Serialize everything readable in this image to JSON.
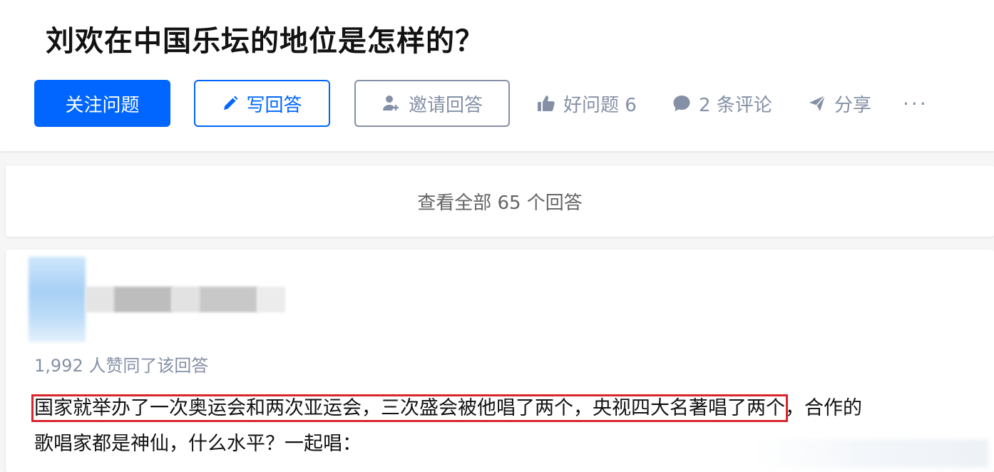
{
  "question": {
    "title": "刘欢在中国乐坛的地位是怎样的？",
    "follow_label": "关注问题",
    "write_label": "写回答",
    "invite_label": "邀请回答",
    "good_question": "好问题 6",
    "comments": "2 条评论",
    "share": "分享",
    "more": "···"
  },
  "view_all": {
    "label": "查看全部 65 个回答"
  },
  "answer": {
    "votes": "1,992 人赞同了该回答",
    "highlighted": "国家就举办了一次奥运会和两次亚运会，三次盛会被他唱了两个，央视四大名著唱了两个",
    "line1_rest": "，合作的",
    "line2": "歌唱家都是神仙，什么水平？一起唱："
  },
  "colors": {
    "accent": "#0066ff",
    "muted": "#8590a6",
    "highlight_border": "#d9262c"
  },
  "icons": [
    "pencil-icon",
    "invite-user-icon",
    "thumbs-up-icon",
    "comment-icon",
    "share-icon"
  ]
}
